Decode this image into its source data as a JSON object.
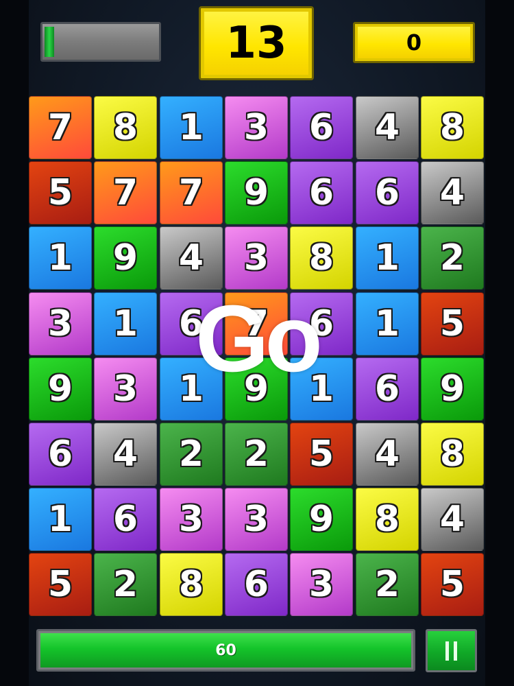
{
  "hud": {
    "target": "13",
    "score": "0",
    "level_progress": 0.08
  },
  "overlay": {
    "text": "Go"
  },
  "timer": {
    "value": "60",
    "progress": 1.0
  },
  "colors": {
    "orange": [
      "#ff9a1a",
      "#ff4a3a"
    ],
    "yellow": [
      "#fbfb45",
      "#d4d400"
    ],
    "blue": [
      "#34b0ff",
      "#1a78e0"
    ],
    "pink": [
      "#f58cf0",
      "#b33ac9"
    ],
    "purple": [
      "#b56af0",
      "#7f28c8"
    ],
    "gray": [
      "#c9c9c9",
      "#5a5a5a"
    ],
    "red": [
      "#e34411",
      "#a81d12"
    ],
    "green": [
      "#2cdc2c",
      "#0a9a0a"
    ],
    "darkgreen": [
      "#4bb44b",
      "#1f7a1f"
    ]
  },
  "grid": [
    [
      {
        "n": "7",
        "c": "orange"
      },
      {
        "n": "8",
        "c": "yellow"
      },
      {
        "n": "1",
        "c": "blue"
      },
      {
        "n": "3",
        "c": "pink"
      },
      {
        "n": "6",
        "c": "purple"
      },
      {
        "n": "4",
        "c": "gray"
      },
      {
        "n": "8",
        "c": "yellow"
      }
    ],
    [
      {
        "n": "5",
        "c": "red"
      },
      {
        "n": "7",
        "c": "orange"
      },
      {
        "n": "7",
        "c": "orange"
      },
      {
        "n": "9",
        "c": "green"
      },
      {
        "n": "6",
        "c": "purple"
      },
      {
        "n": "6",
        "c": "purple"
      },
      {
        "n": "4",
        "c": "gray"
      }
    ],
    [
      {
        "n": "1",
        "c": "blue"
      },
      {
        "n": "9",
        "c": "green"
      },
      {
        "n": "4",
        "c": "gray"
      },
      {
        "n": "3",
        "c": "pink"
      },
      {
        "n": "8",
        "c": "yellow"
      },
      {
        "n": "1",
        "c": "blue"
      },
      {
        "n": "2",
        "c": "darkgreen"
      }
    ],
    [
      {
        "n": "3",
        "c": "pink"
      },
      {
        "n": "1",
        "c": "blue"
      },
      {
        "n": "6",
        "c": "purple"
      },
      {
        "n": "7",
        "c": "orange"
      },
      {
        "n": "6",
        "c": "purple"
      },
      {
        "n": "1",
        "c": "blue"
      },
      {
        "n": "5",
        "c": "red"
      }
    ],
    [
      {
        "n": "9",
        "c": "green"
      },
      {
        "n": "3",
        "c": "pink"
      },
      {
        "n": "1",
        "c": "blue"
      },
      {
        "n": "9",
        "c": "green"
      },
      {
        "n": "1",
        "c": "blue"
      },
      {
        "n": "6",
        "c": "purple"
      },
      {
        "n": "9",
        "c": "green"
      }
    ],
    [
      {
        "n": "6",
        "c": "purple"
      },
      {
        "n": "4",
        "c": "gray"
      },
      {
        "n": "2",
        "c": "darkgreen"
      },
      {
        "n": "2",
        "c": "darkgreen"
      },
      {
        "n": "5",
        "c": "red"
      },
      {
        "n": "4",
        "c": "gray"
      },
      {
        "n": "8",
        "c": "yellow"
      }
    ],
    [
      {
        "n": "1",
        "c": "blue"
      },
      {
        "n": "6",
        "c": "purple"
      },
      {
        "n": "3",
        "c": "pink"
      },
      {
        "n": "3",
        "c": "pink"
      },
      {
        "n": "9",
        "c": "green"
      },
      {
        "n": "8",
        "c": "yellow"
      },
      {
        "n": "4",
        "c": "gray"
      }
    ],
    [
      {
        "n": "5",
        "c": "red"
      },
      {
        "n": "2",
        "c": "darkgreen"
      },
      {
        "n": "8",
        "c": "yellow"
      },
      {
        "n": "6",
        "c": "purple"
      },
      {
        "n": "3",
        "c": "pink"
      },
      {
        "n": "2",
        "c": "darkgreen"
      },
      {
        "n": "5",
        "c": "red"
      }
    ]
  ],
  "pause": {
    "icon": "pause-icon"
  }
}
